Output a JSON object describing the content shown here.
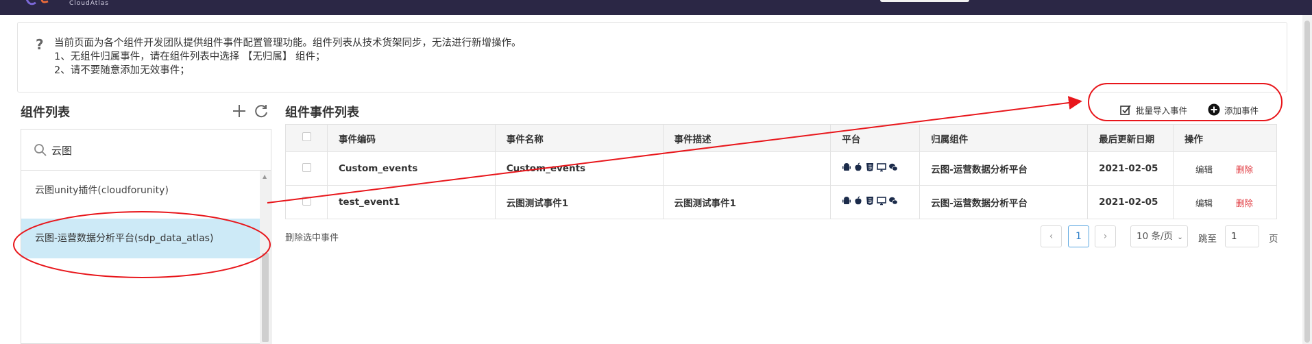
{
  "header": {
    "brand": "CloudAtlas"
  },
  "notice": {
    "icon": "question-icon",
    "lines": [
      "当前页面为各个组件开发团队提供组件事件配置管理功能。组件列表从技术货架同步，无法进行新增操作。",
      "1、无组件归属事件，请在组件列表中选择 【无归属】 组件；",
      "2、请不要随意添加无效事件；"
    ]
  },
  "components": {
    "title": "组件列表",
    "search_value": "云图",
    "items": [
      {
        "label": "云图unity插件(cloudforunity)"
      },
      {
        "label": "云图-运营数据分析平台(sdp_data_atlas)",
        "selected": true
      }
    ]
  },
  "events": {
    "title": "组件事件列表",
    "import_label": "批量导入事件",
    "add_label": "添加事件",
    "columns": [
      "",
      "事件编码",
      "事件名称",
      "事件描述",
      "平台",
      "归属组件",
      "最后更新日期",
      "操作"
    ],
    "rows": [
      {
        "code": "Custom_events",
        "name": "Custom_events",
        "desc": "",
        "component": "云图-运营数据分析平台",
        "updated": "2021-02-05",
        "edit": "编辑",
        "delete": "删除"
      },
      {
        "code": "test_event1",
        "name": "云图测试事件1",
        "desc": "云图测试事件1",
        "component": "云图-运营数据分析平台",
        "updated": "2021-02-05",
        "edit": "编辑",
        "delete": "删除"
      }
    ],
    "platform_icons": [
      "android-icon",
      "apple-icon",
      "html5-icon",
      "desktop-icon",
      "wechat-icon"
    ],
    "bulk_delete_label": "删除选中事件"
  },
  "pagination": {
    "prev": "‹",
    "current": "1",
    "next": "›",
    "page_size": "10 条/页",
    "jump_label": "跳至",
    "jump_value": "1",
    "page_unit": "页"
  },
  "colors": {
    "topbar": "#2b2745",
    "selected_item": "#cdeaf7",
    "delete": "#e0383e",
    "annotation": "#e8161b",
    "active_page": "#57a5e0"
  }
}
